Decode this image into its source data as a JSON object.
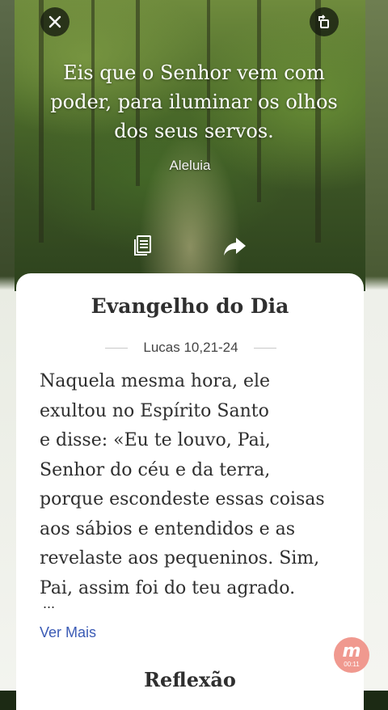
{
  "hero": {
    "quote_lines": [
      "Eis que o Senhor vem com",
      "poder, para iluminar os olhos",
      "dos seus servos."
    ],
    "acclamation": "Aleluia",
    "icons": {
      "close": "close-icon",
      "rotate": "rotate-icon",
      "reading": "reading-icon",
      "share": "share-icon"
    }
  },
  "gospel": {
    "title": "Evangelho do Dia",
    "reference": "Lucas 10,21-24",
    "text_lines": [
      "Naquela mesma hora, ele",
      "exultou no Espírito Santo",
      "e disse: «Eu te louvo, Pai,",
      "Senhor do céu e da terra,",
      "porque escondeste essas coisas",
      "aos sábios e entendidos e as",
      "revelaste aos pequeninos. Sim,",
      "Pai, assim foi do teu agrado."
    ],
    "ellipsis": "...",
    "more_label": "Ver Mais"
  },
  "reflection": {
    "title": "Reflexão"
  },
  "recorder": {
    "letter": "m",
    "time": "00:11"
  },
  "colors": {
    "link": "#3b5bb5",
    "badge": "#f0998f",
    "title": "#2f2f2f"
  }
}
